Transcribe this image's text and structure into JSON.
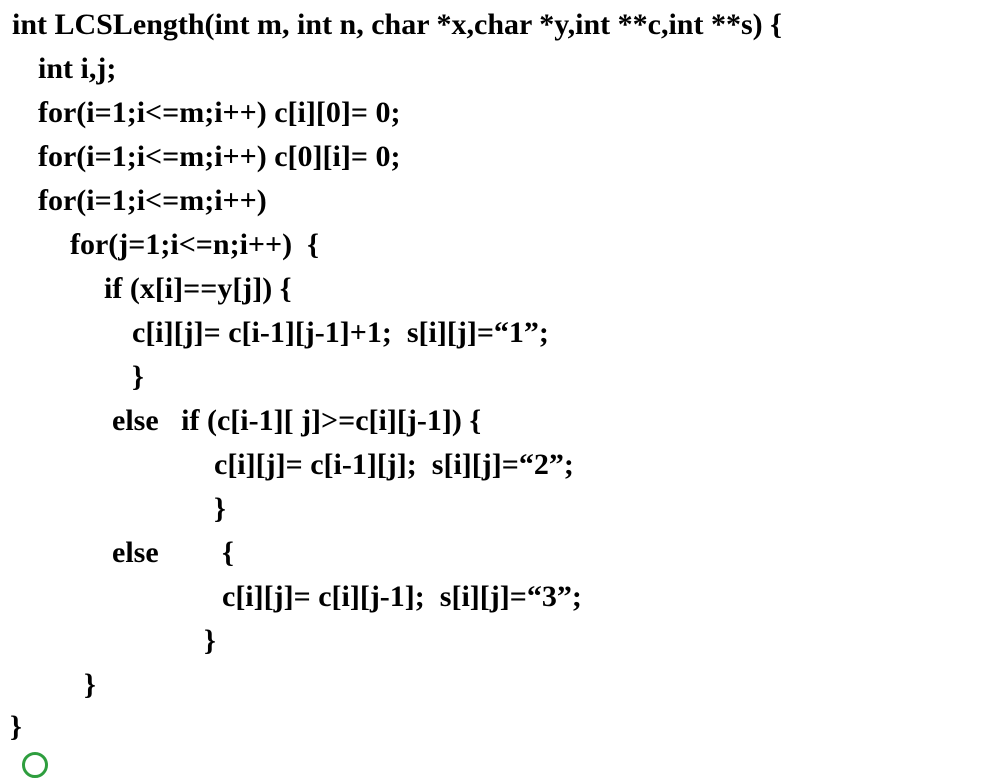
{
  "code": {
    "lines": [
      "int LCSLength(int m, int n, char *x,char *y,int **c,int **s) {",
      "int i,j;",
      "for(i=1;i<=m;i++) c[i][0]= 0;",
      "for(i=1;i<=m;i++) c[0][i]= 0;",
      "for(i=1;i<=m;i++)",
      "for(j=1;i<=n;i++)  {",
      "if (x[i]==y[j]) {",
      "c[i][j]= c[i-1][j-1]+1;  s[i][j]=“1”;",
      "}",
      "else   if (c[i-1][ j]>=c[i][j-1]) {",
      "c[i][j]= c[i-1][j];  s[i][j]=“2”;",
      "}",
      "else",
      "{",
      "c[i][j]= c[i][j-1];  s[i][j]=“3”;",
      "}",
      "}",
      "}"
    ]
  },
  "colors": {
    "text": "#000000",
    "background": "#ffffff",
    "accent": "#2e9e3e"
  }
}
